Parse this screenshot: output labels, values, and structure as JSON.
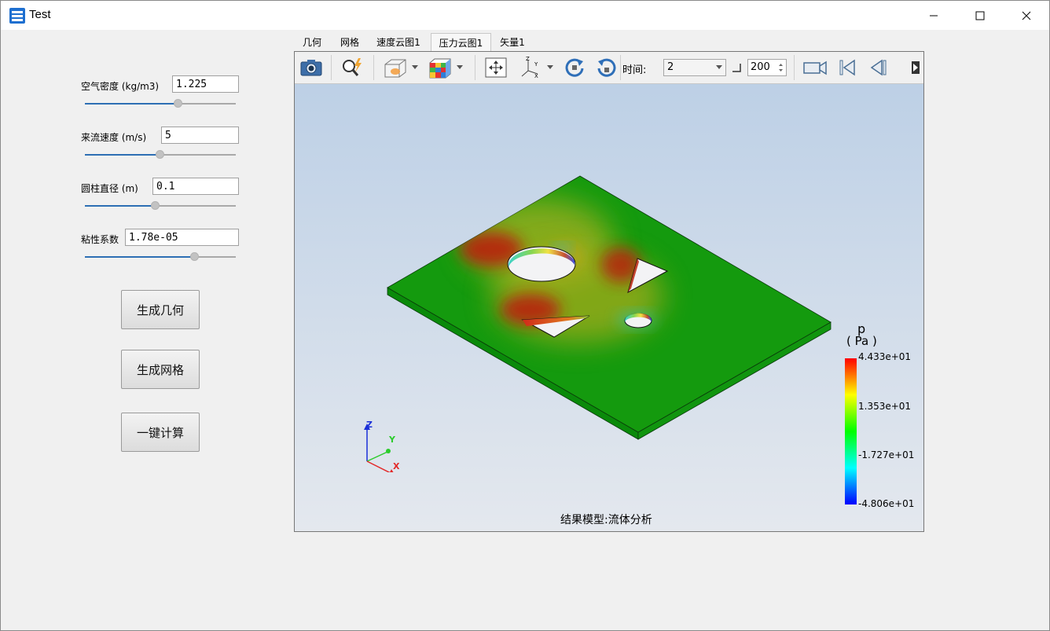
{
  "window": {
    "title": "Test"
  },
  "params": [
    {
      "label": "空气密度 (kg/m3)",
      "value": "1.225",
      "slider_fraction": 0.62
    },
    {
      "label": "来流速度 (m/s)",
      "value": "5",
      "slider_fraction": 0.5
    },
    {
      "label": "圆柱直径 (m)",
      "value": "0.1",
      "slider_fraction": 0.47
    },
    {
      "label": "粘性系数",
      "value": "1.78e-05",
      "slider_fraction": 0.73
    }
  ],
  "buttons": {
    "geometry": "生成几何",
    "mesh": "生成网格",
    "compute": "一键计算"
  },
  "tabs": [
    "几何",
    "网格",
    "速度云图1",
    "压力云图1",
    "矢量1"
  ],
  "active_tab": "压力云图1",
  "toolbar": {
    "time_label": "时间:",
    "time_value": "2",
    "frame_value": "200"
  },
  "legend": {
    "variable": "p",
    "unit": "( Pa )",
    "ticks": [
      "4.433e+01",
      "1.353e+01",
      "-1.727e+01",
      "-4.806e+01"
    ],
    "colors": [
      "#0000ff",
      "#00ffff",
      "#00ff00",
      "#ffff00",
      "#ff0000"
    ]
  },
  "axes": {
    "x": "X",
    "y": "Y",
    "z": "Z"
  },
  "footer": "结果模型:流体分析"
}
